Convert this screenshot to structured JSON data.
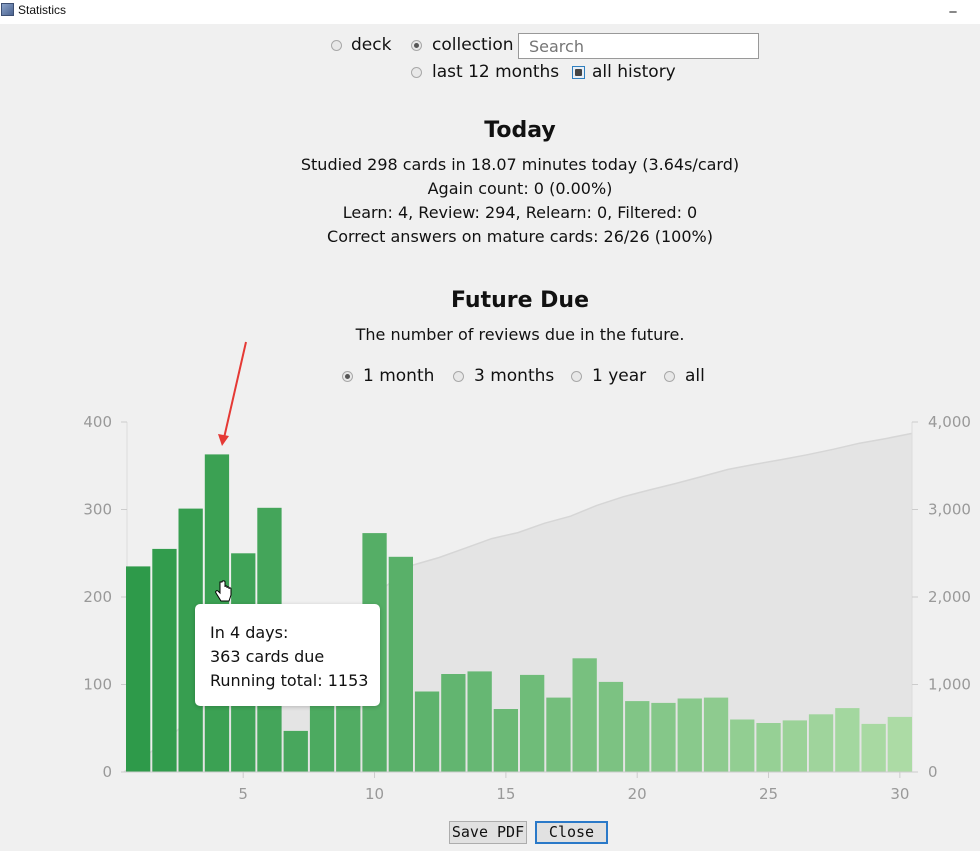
{
  "window": {
    "title": "Statistics",
    "minimize_glyph": "_"
  },
  "scope": {
    "deck_label": "deck",
    "collection_label": "collection",
    "selected_scope": "collection",
    "search_placeholder": "Search",
    "search_value": "",
    "period_12_label": "last 12 months",
    "all_history_label": "all history",
    "selected_period": "all history"
  },
  "today": {
    "heading": "Today",
    "line1": "Studied 298 cards in 18.07 minutes today (3.64s/card)",
    "line2": "Again count: 0 (0.00%)",
    "line3": "Learn: 4, Review: 294, Relearn: 0, Filtered: 0",
    "line4": "Correct answers on mature cards: 26/26 (100%)"
  },
  "future_due": {
    "heading": "Future Due",
    "subtitle": "The number of reviews due in the future.",
    "ranges": [
      "1 month",
      "3 months",
      "1 year",
      "all"
    ],
    "selected_range": "1 month"
  },
  "tooltip": {
    "line1": "In 4 days:",
    "line2": "363 cards due",
    "line3": "Running total: 1153"
  },
  "buttons": {
    "save_pdf": "Save PDF",
    "close": "Close"
  },
  "colors": {
    "bar_dark": "#2e9a4a",
    "bar_light": "#acdba5",
    "cumulative_fill": "#e3e3e3",
    "annotation_arrow": "#e53935"
  },
  "chart_data": {
    "type": "bar",
    "x": [
      1,
      2,
      3,
      4,
      5,
      6,
      7,
      8,
      9,
      10,
      11,
      12,
      13,
      14,
      15,
      16,
      17,
      18,
      19,
      20,
      21,
      22,
      23,
      24,
      25,
      26,
      27,
      28,
      29,
      30
    ],
    "values": [
      235,
      255,
      301,
      363,
      250,
      302,
      47,
      90,
      120,
      273,
      246,
      92,
      112,
      115,
      72,
      111,
      85,
      130,
      103,
      81,
      79,
      84,
      85,
      60,
      56,
      59,
      66,
      73,
      55,
      63
    ],
    "cumulative_overlay": {
      "axis": "right",
      "approx_endpoint": 3870
    },
    "x_ticks": [
      5,
      10,
      15,
      20,
      25,
      30
    ],
    "y_ticks_left": [
      "0",
      "100",
      "200",
      "300",
      "400"
    ],
    "y_ticks_right": [
      "0",
      "1,000",
      "2,000",
      "3,000",
      "4,000"
    ],
    "ylim_left": [
      0,
      400
    ],
    "ylim_right": [
      0,
      4000
    ]
  }
}
